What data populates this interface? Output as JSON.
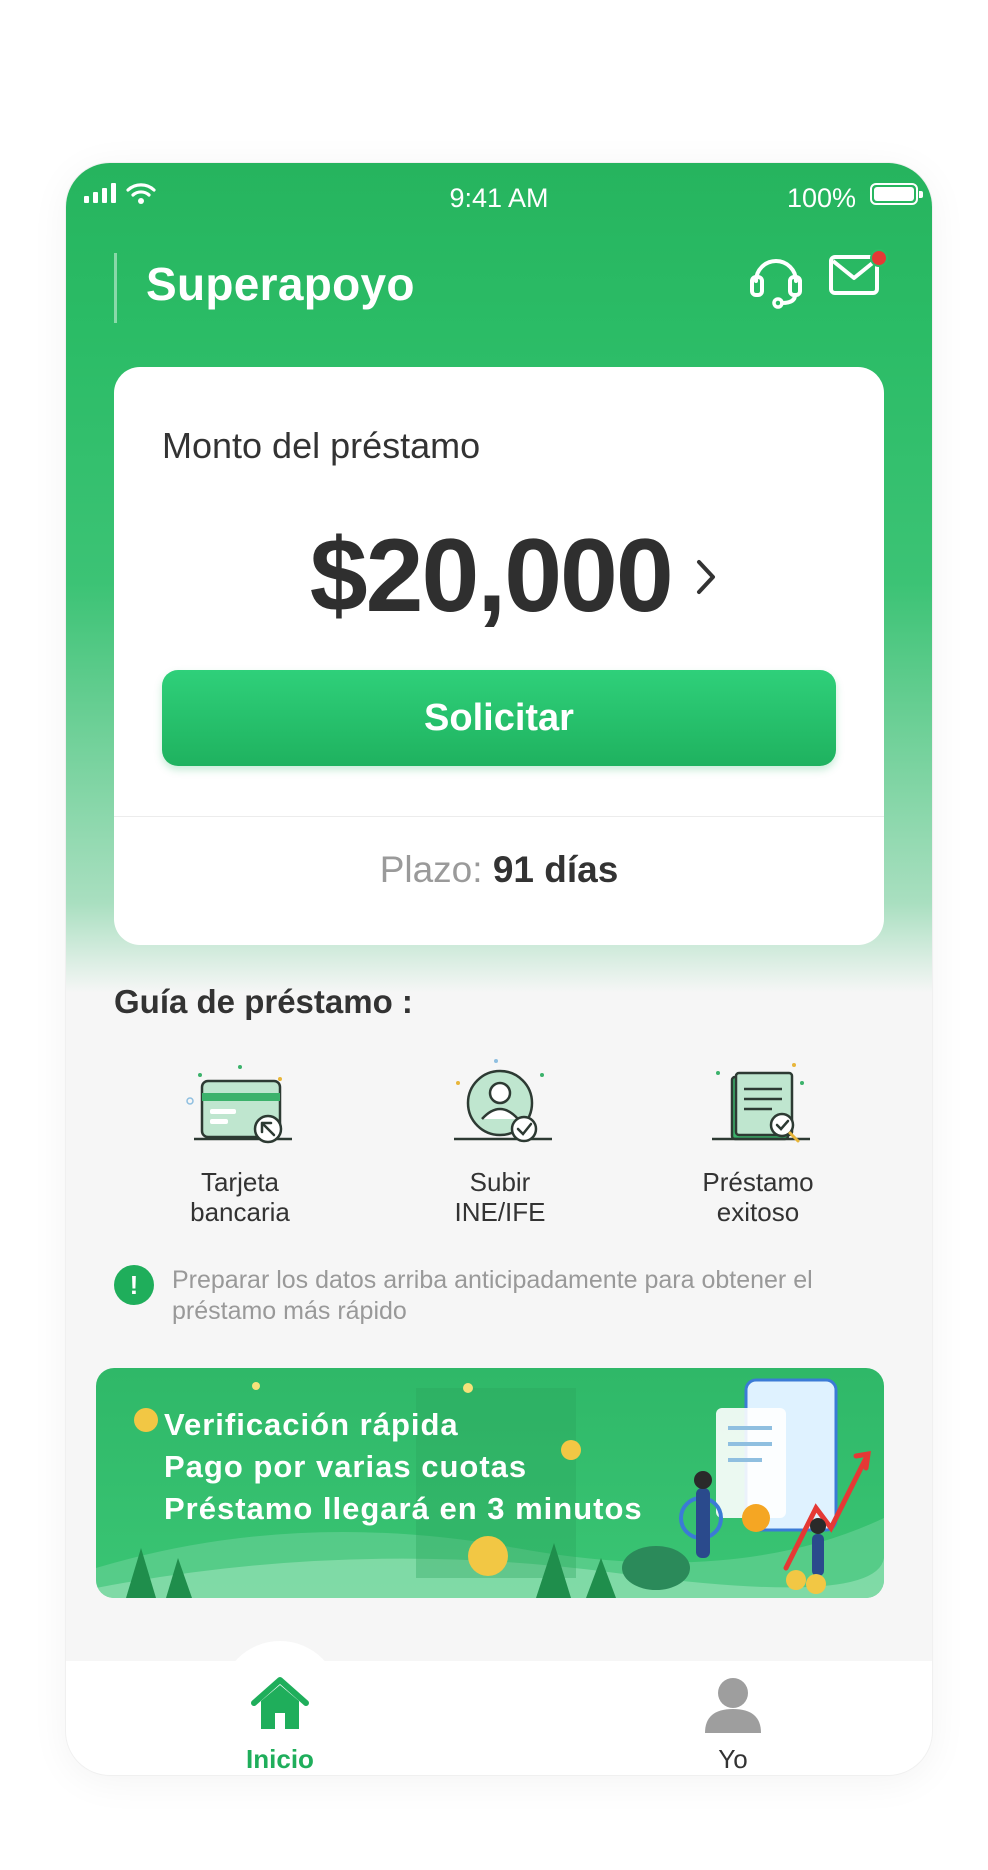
{
  "status_bar": {
    "time": "9:41 AM",
    "battery": "100%"
  },
  "header": {
    "title": "Superapoyo",
    "icons": [
      "headset-icon",
      "mail-icon"
    ],
    "has_unread": true
  },
  "loan_card": {
    "amount_label": "Monto del préstamo",
    "amount": "$20,000",
    "apply_label": "Solicitar",
    "term_label": "Plazo:",
    "term_value": "91 días"
  },
  "guide": {
    "title": "Guía de préstamo :",
    "steps": [
      {
        "line1": "Tarjeta",
        "line2": "bancaria",
        "icon": "bank-card-icon"
      },
      {
        "line1": "Subir",
        "line2": "INE/IFE",
        "icon": "id-upload-icon"
      },
      {
        "line1": "Préstamo",
        "line2": "exitoso",
        "icon": "loan-success-icon"
      }
    ]
  },
  "tip": {
    "icon": "!",
    "text": "Preparar los datos arriba anticipadamente para obtener el préstamo más rápido"
  },
  "banner": {
    "lines": [
      "Verificación rápida",
      "Pago por varias cuotas",
      "Préstamo llegará en 3 minutos"
    ]
  },
  "tabs": [
    {
      "label": "Inicio",
      "icon": "home-icon",
      "active": true
    },
    {
      "label": "Yo",
      "icon": "user-icon",
      "active": false
    }
  ],
  "colors": {
    "primary": "#26b45e",
    "text": "#333333",
    "muted": "#999999",
    "alert_dot": "#e53935"
  }
}
